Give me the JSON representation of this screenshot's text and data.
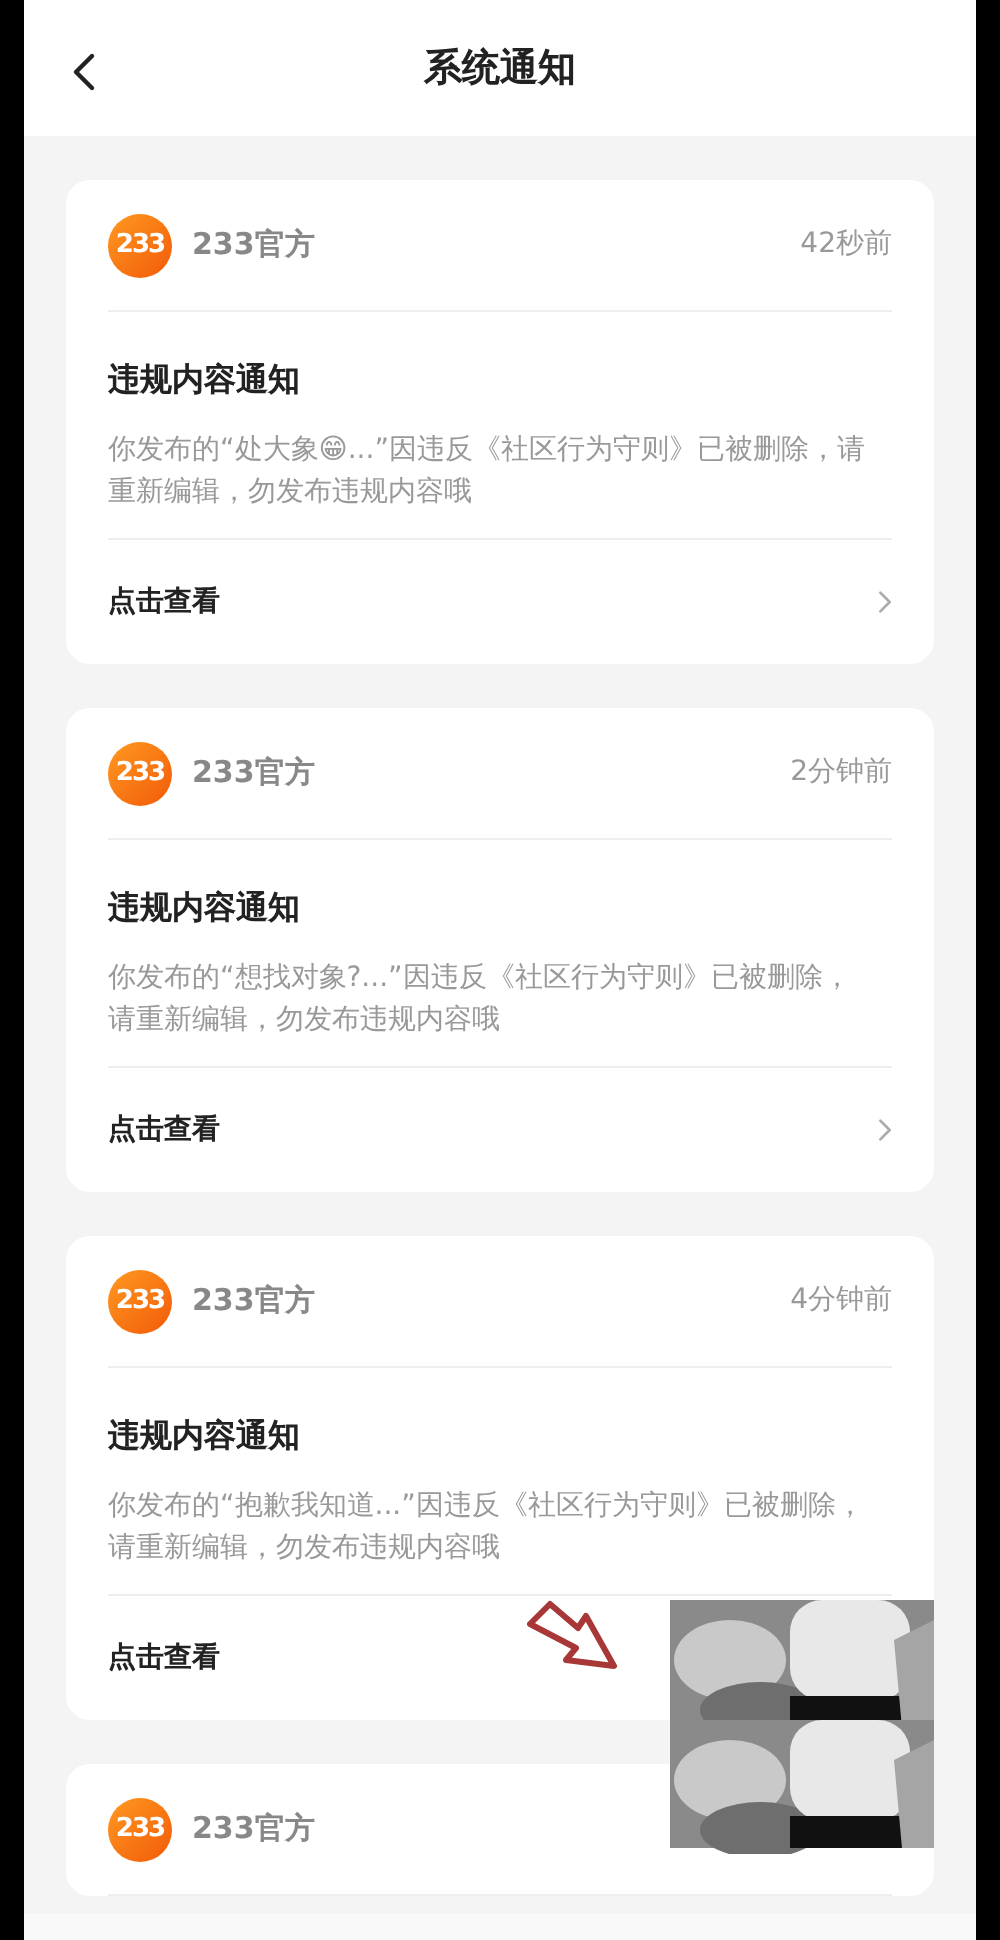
{
  "header": {
    "title": "系统通知"
  },
  "notifications": [
    {
      "logo_text": "233",
      "sender": "233官方",
      "time": "42秒前",
      "title": "违规内容通知",
      "body": "你发布的“处大象😁...”因违反《社区行为守则》已被删除，请重新编辑，勿发布违规内容哦",
      "action": "点击查看",
      "chevron": true
    },
    {
      "logo_text": "233",
      "sender": "233官方",
      "time": "2分钟前",
      "title": "违规内容通知",
      "body": "你发布的“想找对象?...”因违反《社区行为守则》已被删除，请重新编辑，勿发布违规内容哦",
      "action": "点击查看",
      "chevron": true
    },
    {
      "logo_text": "233",
      "sender": "233官方",
      "time": "4分钟前",
      "title": "违规内容通知",
      "body": "你发布的“抱歉我知道...”因违反《社区行为守则》已被删除，请重新编辑，勿发布违规内容哦",
      "action": "点击查看",
      "chevron": false
    },
    {
      "logo_text": "233",
      "sender": "233官方"
    }
  ]
}
